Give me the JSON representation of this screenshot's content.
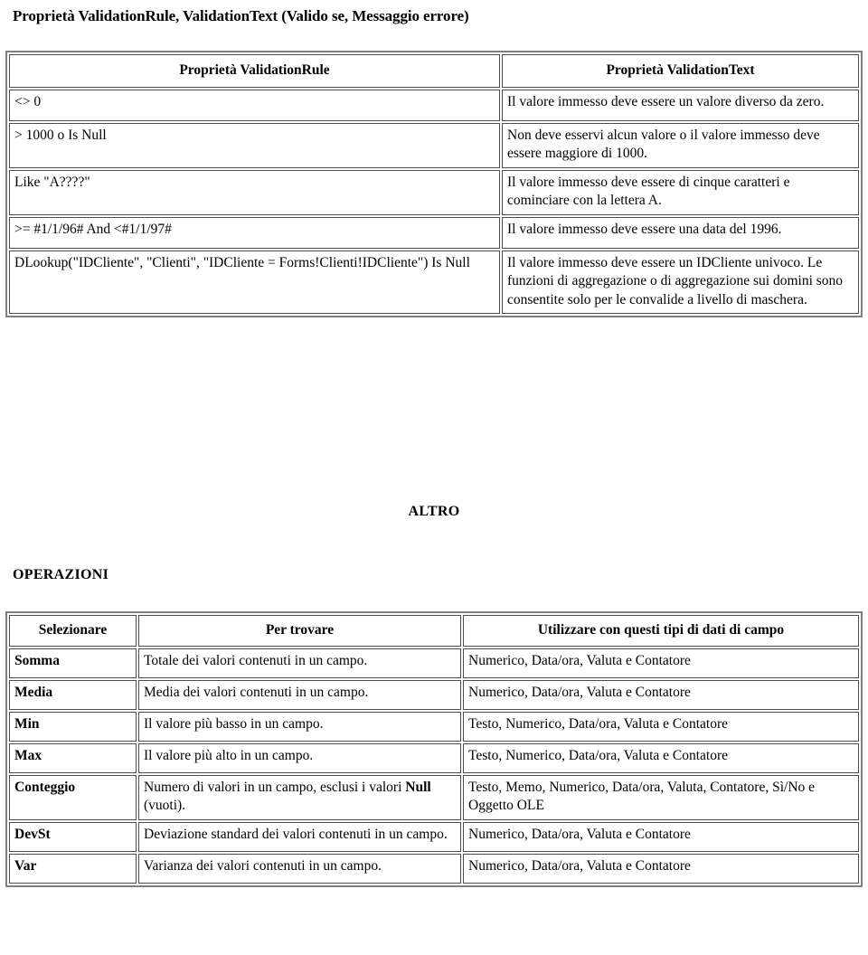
{
  "document": {
    "title": "Proprietà ValidationRule, ValidationText (Valido se, Messaggio errore)",
    "section_altro": "ALTRO",
    "section_operazioni": "OPERAZIONI"
  },
  "validation_table": {
    "headers": [
      "Proprietà ValidationRule",
      "Proprietà ValidationText"
    ],
    "rows": [
      {
        "rule": "<> 0",
        "text": "Il valore immesso deve essere un valore diverso da zero."
      },
      {
        "rule": "> 1000 o Is Null",
        "text": "Non deve esservi alcun valore o il valore immesso deve essere maggiore di 1000."
      },
      {
        "rule": "Like \"A????\"",
        "text": "Il valore immesso deve essere di cinque caratteri e cominciare con la lettera A."
      },
      {
        "rule": ">= #1/1/96# And <#1/1/97#",
        "text": "Il valore immesso deve essere una data del 1996."
      },
      {
        "rule": "DLookup(\"IDCliente\", \"Clienti\", \"IDCliente = Forms!Clienti!IDCliente\") Is Null",
        "text": "Il valore immesso deve essere un IDCliente univoco. Le funzioni di aggregazione o di aggregazione sui domini sono consentite solo per le convalide a livello di maschera."
      }
    ]
  },
  "operations_table": {
    "headers": [
      "Selezionare",
      "Per trovare",
      "Utilizzare con questi tipi di dati di campo"
    ],
    "rows": [
      {
        "select": "Somma",
        "find": "Totale dei valori contenuti in un campo.",
        "types": "Numerico, Data/ora, Valuta e Contatore"
      },
      {
        "select": "Media",
        "find": "Media dei valori contenuti in un campo.",
        "types": "Numerico, Data/ora, Valuta e Contatore"
      },
      {
        "select": "Min",
        "find": "Il valore più basso in un campo.",
        "types": "Testo, Numerico, Data/ora, Valuta e Contatore"
      },
      {
        "select": "Max",
        "find": "Il valore più alto in un campo.",
        "types": "Testo, Numerico, Data/ora, Valuta e Contatore"
      },
      {
        "select": "Conteggio",
        "find_before_bold": "Numero di valori in un campo, esclusi i valori ",
        "find_bold": "Null",
        "find_after_bold": " (vuoti).",
        "types": "Testo, Memo, Numerico, Data/ora, Valuta, Contatore, Sì/No e Oggetto OLE"
      },
      {
        "select": "DevSt",
        "find": "Deviazione standard dei valori contenuti in un campo.",
        "types": "Numerico, Data/ora, Valuta e Contatore"
      },
      {
        "select": "Var",
        "find": "Varianza dei valori contenuti in un campo.",
        "types": "Numerico, Data/ora, Valuta e Contatore"
      }
    ]
  },
  "colors": {
    "page_background": "#ffffff",
    "text": "#000000",
    "cell_border": "#4d4d4d",
    "table_outer_border": "#808080"
  }
}
